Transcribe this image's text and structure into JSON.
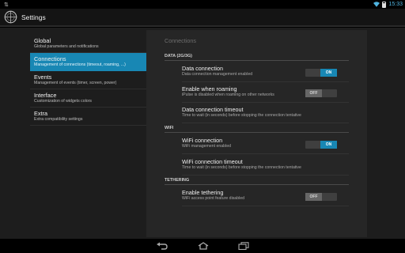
{
  "statusbar": {
    "notification_icon": "usb-icon",
    "time": "15:33"
  },
  "actionbar": {
    "title": "Settings",
    "icon": "compass-icon"
  },
  "headers": [
    {
      "title": "Global",
      "subtitle": "Global parameters and notifications",
      "active": false
    },
    {
      "title": "Connections",
      "subtitle": "Management of connections (timeout, roaming, ...)",
      "active": true
    },
    {
      "title": "Events",
      "subtitle": "Management of events (timer, screen, power)",
      "active": false
    },
    {
      "title": "Interface",
      "subtitle": "Customization of widgets colors",
      "active": false
    },
    {
      "title": "Extra",
      "subtitle": "Extra compatibility settings",
      "active": false
    }
  ],
  "detail": {
    "breadcrumb": "Connections",
    "categories": {
      "data": "DATA (2G/3G)",
      "wifi": "WIFI",
      "tethering": "TETHERING"
    },
    "prefs": {
      "data_connection": {
        "title": "Data connection",
        "summary": "Data connection management enabled",
        "toggle": "ON"
      },
      "roaming": {
        "title": "Enable when roaming",
        "summary": "iPulse is disabled when roaming on other networks",
        "toggle": "OFF"
      },
      "data_timeout": {
        "title": "Data connection timeout",
        "summary": "Time to wait (in seconds) before stopping the connection tentative"
      },
      "wifi_connection": {
        "title": "WiFi connection",
        "summary": "WiFi management enabled",
        "toggle": "ON"
      },
      "wifi_timeout": {
        "title": "WiFi connection timeout",
        "summary": "Time to wait (in seconds) before stopping the connection tentative"
      },
      "tethering": {
        "title": "Enable tethering",
        "summary": "WiFi access point feature disabled",
        "toggle": "OFF"
      }
    }
  },
  "colors": {
    "accent": "#1887b4",
    "background": "#1d1d1d",
    "panel": "#262626"
  }
}
